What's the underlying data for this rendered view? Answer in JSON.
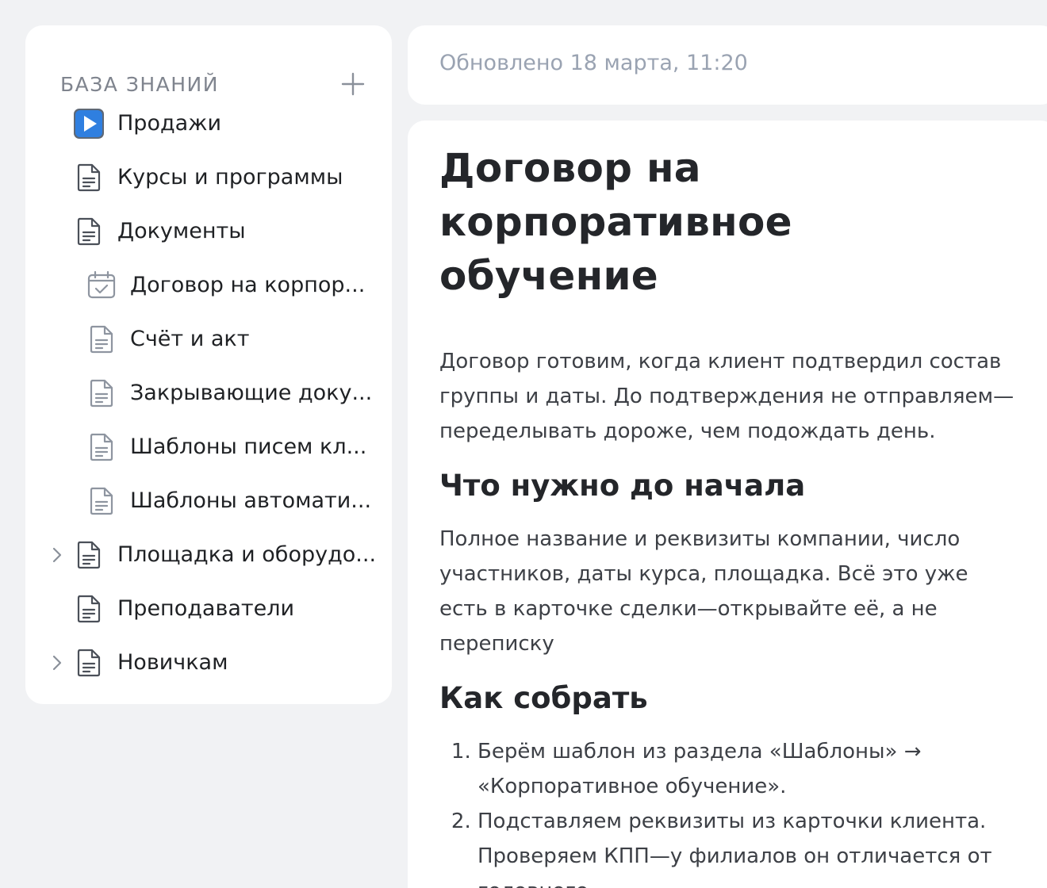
{
  "sidebar": {
    "title": "БАЗА ЗНАНИЙ",
    "add_icon": "plus-icon",
    "items": [
      {
        "label": "Продажи",
        "icon": "play-icon",
        "level": 0,
        "expandable": false
      },
      {
        "label": "Курсы и программы",
        "icon": "document-icon",
        "level": 0,
        "expandable": false
      },
      {
        "label": "Документы",
        "icon": "document-icon",
        "level": 0,
        "expandable": false
      },
      {
        "label": "Договор на корпор...",
        "icon": "calendar-check-icon",
        "level": 1,
        "expandable": false
      },
      {
        "label": "Счёт и акт",
        "icon": "document-icon",
        "level": 1,
        "expandable": false
      },
      {
        "label": "Закрывающие доку...",
        "icon": "document-icon",
        "level": 1,
        "expandable": false
      },
      {
        "label": "Шаблоны писем кл...",
        "icon": "document-icon",
        "level": 1,
        "expandable": false
      },
      {
        "label": "Шаблоны автомати...",
        "icon": "document-icon",
        "level": 1,
        "expandable": false
      },
      {
        "label": "Площадка и оборудо...",
        "icon": "document-icon",
        "level": 0,
        "expandable": true
      },
      {
        "label": "Преподаватели",
        "icon": "document-icon",
        "level": 0,
        "expandable": false
      },
      {
        "label": "Новичкам",
        "icon": "document-icon",
        "level": 0,
        "expandable": true
      }
    ]
  },
  "updated": {
    "text": "Обновлено 18 марта, 11:20"
  },
  "document": {
    "title": "Договор на корпоративное обучение",
    "intro": "Договор готовим, когда клиент подтвердил состав группы и даты. До подтверждения не отправляем—переделывать дороже, чем подождать день.",
    "section1_heading": "Что нужно до начала",
    "section1_text": "Полное название и реквизиты компании, число участников, даты курса, площадка. Всё это уже есть в карточке сделки—открывайте её, а не переписку",
    "section2_heading": "Как собрать",
    "steps": [
      "Берём шаблон из раздела «Шаблоны» → «Корпоративное обучение».",
      "Подставляем реквизиты из карточки клиента. Проверяем КПП—у филиалов он отличается от головного."
    ]
  },
  "colors": {
    "background": "#f1f2f4",
    "card": "#ffffff",
    "muted_text": "#9aa3b2",
    "play_icon_blue": "#2f7fe0"
  }
}
